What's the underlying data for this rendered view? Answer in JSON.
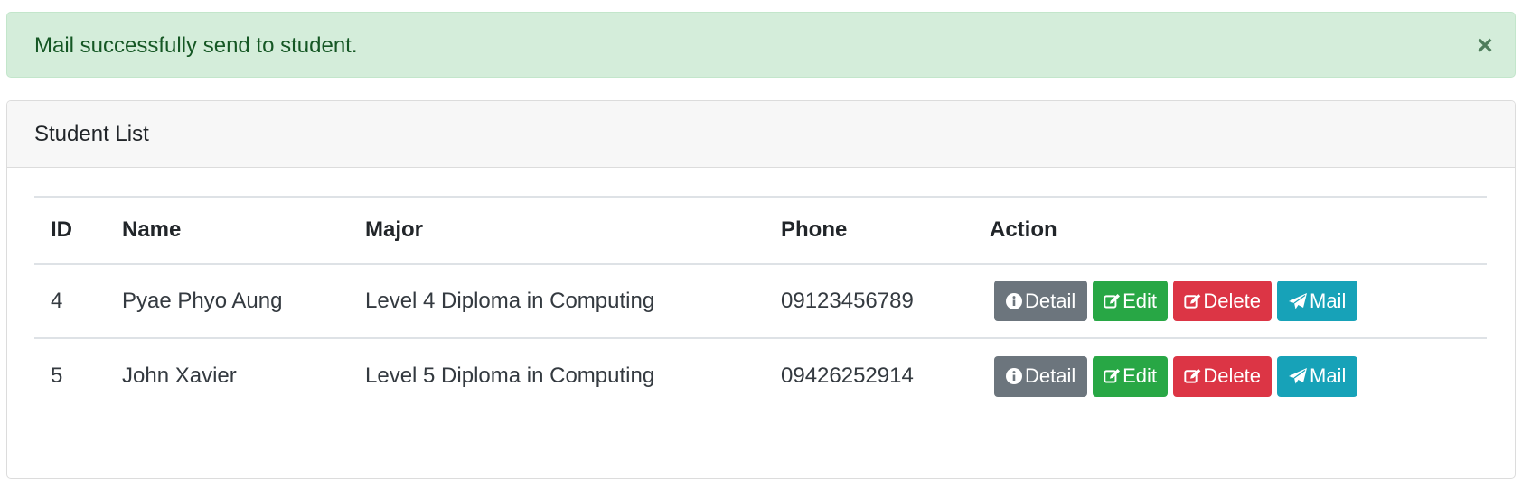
{
  "alert": {
    "message": "Mail successfully send to student.",
    "close_symbol": "×",
    "color": "#d4edda"
  },
  "card": {
    "title": "Student List"
  },
  "table": {
    "headers": [
      "ID",
      "Name",
      "Major",
      "Phone",
      "Action"
    ],
    "rows": [
      {
        "id": "4",
        "name": "Pyae Phyo Aung",
        "major": "Level 4 Diploma in Computing",
        "phone": "09123456789"
      },
      {
        "id": "5",
        "name": "John Xavier",
        "major": "Level 5 Diploma in Computing",
        "phone": "09426252914"
      }
    ],
    "actions": {
      "detail": "Detail",
      "edit": "Edit",
      "delete": "Delete",
      "mail": "Mail"
    }
  },
  "colors": {
    "detail": "#6c757d",
    "edit": "#28a745",
    "delete": "#dc3545",
    "mail": "#17a2b8"
  },
  "icons": {
    "detail": "info-circle-icon",
    "edit": "edit-icon",
    "delete": "edit-icon",
    "mail": "paper-plane-icon"
  }
}
